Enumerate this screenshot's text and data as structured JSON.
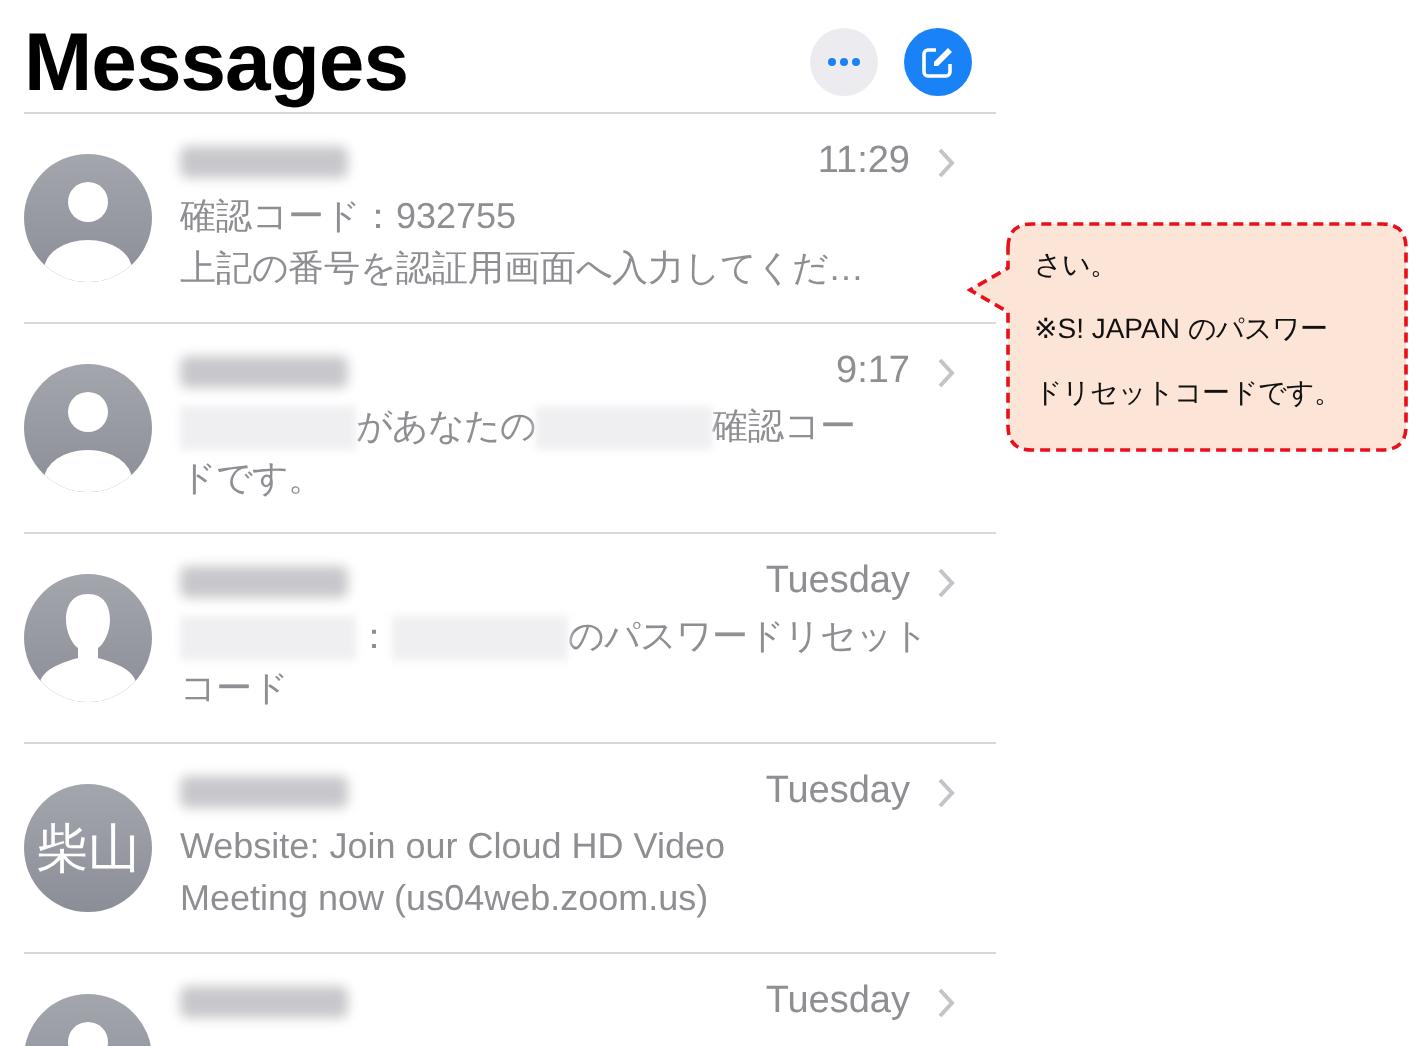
{
  "header": {
    "title": "Messages"
  },
  "conversations": [
    {
      "avatar": {
        "kind": "person"
      },
      "time": "11:29",
      "body": [
        {
          "kind": "text",
          "text": "確認コード：932755\n上記の番号を認証用画面へ入力してくだ…"
        }
      ]
    },
    {
      "avatar": {
        "kind": "person"
      },
      "time": "9:17",
      "body": [
        {
          "kind": "redacted"
        },
        {
          "kind": "text",
          "text": "があなたの"
        },
        {
          "kind": "redacted"
        },
        {
          "kind": "text",
          "text": "確認コー"
        },
        {
          "kind": "break"
        },
        {
          "kind": "text",
          "text": "ドです。"
        }
      ]
    },
    {
      "avatar": {
        "kind": "silhouette"
      },
      "time": "Tuesday",
      "body": [
        {
          "kind": "redacted"
        },
        {
          "kind": "text",
          "text": "："
        },
        {
          "kind": "redacted"
        },
        {
          "kind": "text",
          "text": "のパスワードリセット"
        },
        {
          "kind": "break"
        },
        {
          "kind": "text",
          "text": "コード"
        }
      ]
    },
    {
      "avatar": {
        "kind": "initials",
        "text": "柴山"
      },
      "time": "Tuesday",
      "body": [
        {
          "kind": "text",
          "text": "Website: Join our Cloud HD Video\nMeeting now (us04web.zoom.us)"
        }
      ]
    },
    {
      "avatar": {
        "kind": "person"
      },
      "time": "Tuesday"
    }
  ],
  "callout": {
    "lines": [
      "さい。",
      "※S! JAPAN のパスワー",
      "ドリセットコードです。"
    ]
  }
}
